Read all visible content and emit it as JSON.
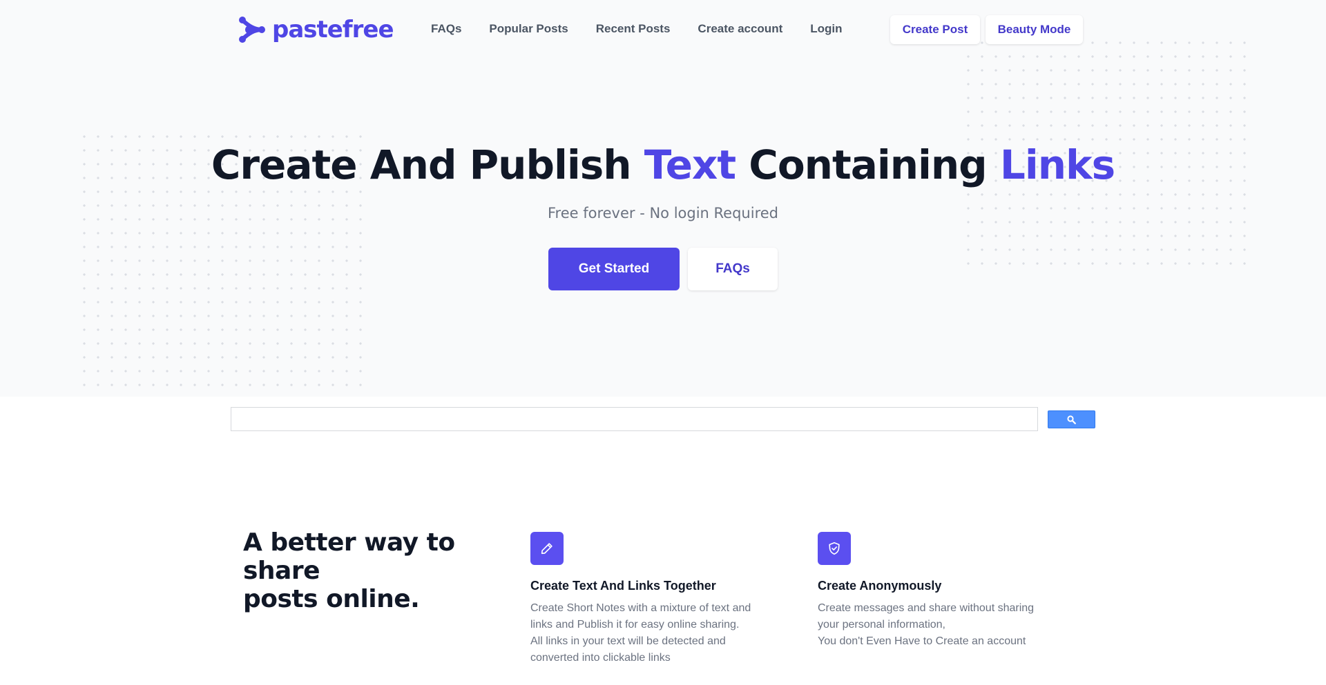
{
  "brand": {
    "name": "pastefree"
  },
  "nav": {
    "links": [
      "FAQs",
      "Popular Posts",
      "Recent Posts",
      "Create account",
      "Login"
    ],
    "create_post": "Create Post",
    "beauty_mode": "Beauty Mode"
  },
  "hero": {
    "title_part1": "Create And Publish ",
    "title_accent1": "Text",
    "title_part2": " Containing ",
    "title_accent2": "Links",
    "subtitle": "Free forever - No login Required",
    "primary_cta": "Get Started",
    "secondary_cta": "FAQs"
  },
  "search": {
    "placeholder": "",
    "button_icon": "search-icon"
  },
  "features": {
    "heading_line1": "A better way to share",
    "heading_line2": "posts online.",
    "items": [
      {
        "icon": "pencil-icon",
        "title": "Create Text And Links Together",
        "lines": [
          "Create Short Notes with a mixture of text and",
          "links and Publish it for easy online sharing.",
          "All links in your text will be detected and",
          "converted into clickable links"
        ]
      },
      {
        "icon": "shield-check-icon",
        "title": "Create Anonymously",
        "lines": [
          "Create messages and share without sharing",
          "your personal information,",
          "You don't Even Have to Create an account"
        ]
      }
    ]
  },
  "colors": {
    "accent": "#4f46e5",
    "hero_bg": "#f9fafb",
    "text_dark": "#111827",
    "text_muted": "#6b7280"
  }
}
